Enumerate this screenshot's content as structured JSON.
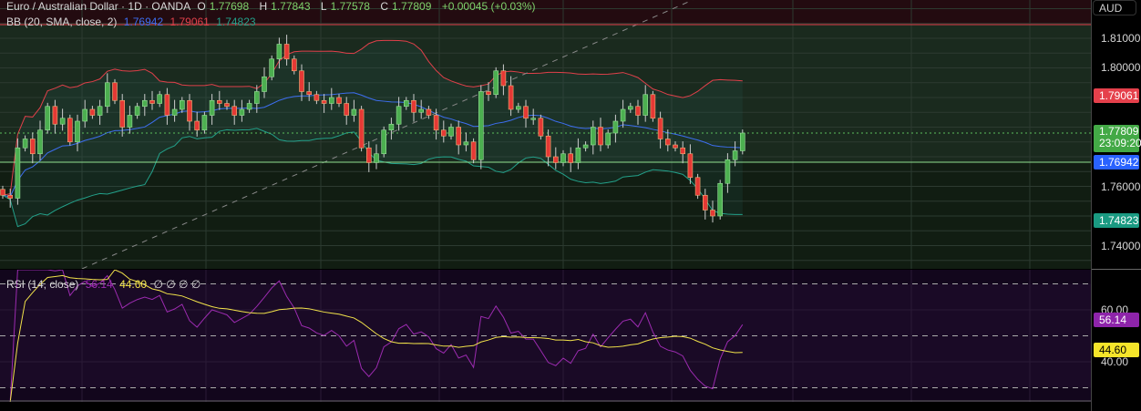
{
  "header": {
    "symbol": "Euro / Australian Dollar · 1D · OANDA",
    "o_label": "O",
    "o": "1.77698",
    "h_label": "H",
    "h": "1.77843",
    "l_label": "L",
    "l": "1.77578",
    "c_label": "C",
    "c": "1.77809",
    "change": "+0.00045 (+0.03%)"
  },
  "bb_legend": {
    "label": "BB (20, SMA, close, 2)",
    "basis": "1.76942",
    "upper": "1.79061",
    "lower": "1.74823"
  },
  "rsi_legend": {
    "label": "RSI (14, close)",
    "rsi": "56.14",
    "ma": "44.60",
    "extras": "∅ ∅ ∅ ∅"
  },
  "scale": {
    "currency": "AUD",
    "ticks": [
      "1.81000",
      "1.80000",
      "1.76000",
      "1.74000"
    ],
    "rsi_ticks": [
      "60.00",
      "40.00"
    ],
    "tags": {
      "upper": "1.79061",
      "price": "1.77809",
      "countdown": "23:09:20",
      "basis": "1.76942",
      "lower": "1.74823",
      "rsi": "56.14",
      "rsi_ma": "44.60"
    }
  },
  "colors": {
    "up": "#4caf50",
    "down": "#e53935",
    "upper": "#e0404a",
    "basis": "#3d6ef0",
    "lower": "#23a18a",
    "rsi": "#9c2bb0",
    "rsi_ma": "#f2e34a"
  },
  "chart_data": {
    "type": "candlestick",
    "title": "Euro / Australian Dollar · 1D · OANDA",
    "ylabel": "AUD",
    "ylim": [
      1.732,
      1.823
    ],
    "rsi_ylim": [
      20,
      80
    ],
    "first_open": 1.759,
    "close": [
      1.757,
      1.756,
      1.773,
      1.776,
      1.771,
      1.779,
      1.787,
      1.781,
      1.783,
      1.775,
      1.782,
      1.786,
      1.784,
      1.787,
      1.795,
      1.789,
      1.78,
      1.784,
      1.787,
      1.789,
      1.788,
      1.791,
      1.784,
      1.786,
      1.789,
      1.782,
      1.779,
      1.784,
      1.789,
      1.788,
      1.787,
      1.784,
      1.786,
      1.788,
      1.792,
      1.797,
      1.803,
      1.808,
      1.803,
      1.799,
      1.792,
      1.791,
      1.789,
      1.788,
      1.79,
      1.788,
      1.784,
      1.786,
      1.773,
      1.768,
      1.771,
      1.779,
      1.781,
      1.787,
      1.789,
      1.785,
      1.786,
      1.784,
      1.779,
      1.777,
      1.78,
      1.774,
      1.775,
      1.769,
      1.792,
      1.791,
      1.799,
      1.794,
      1.786,
      1.787,
      1.783,
      1.783,
      1.777,
      1.77,
      1.768,
      1.771,
      1.768,
      1.773,
      1.774,
      1.78,
      1.774,
      1.778,
      1.782,
      1.786,
      1.787,
      1.784,
      1.791,
      1.783,
      1.776,
      1.774,
      1.773,
      1.771,
      1.763,
      1.757,
      1.752,
      1.75,
      1.761,
      1.769,
      1.772,
      1.778
    ]
  }
}
